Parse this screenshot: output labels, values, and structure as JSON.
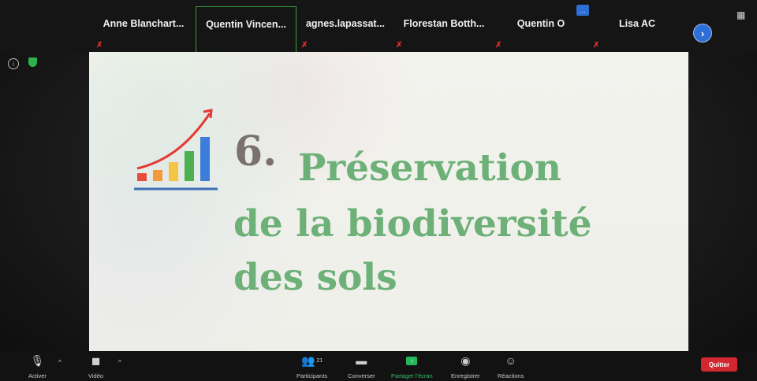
{
  "participants": [
    {
      "name": "Anne  Blanchart..."
    },
    {
      "name": "Quentin  Vincen..."
    },
    {
      "name": "agnes.lapassat..."
    },
    {
      "name": "Florestan  Botth..."
    },
    {
      "name": "Quentin O"
    },
    {
      "name": "Lisa AC"
    }
  ],
  "slide": {
    "number": "6.",
    "title_line1": "Préservation",
    "title_line2": "de la biodiversité",
    "title_line3": "des sols"
  },
  "toolbar": {
    "activer": "Activer",
    "video": "Vidéo",
    "participants": "Participants",
    "participants_count": "21",
    "converser": "Converser",
    "partager": "Partager l'écran",
    "enregistrer": "Enregistrer",
    "reactions": "Réactions",
    "quitter": "Quitter"
  },
  "colors": {
    "slide_title_green": "#6db078",
    "slide_number_gray": "#7a706c",
    "quit_red": "#d3272f",
    "share_green": "#25b55a",
    "accent_blue": "#2d6fd6"
  },
  "icons": [
    "info-icon",
    "shield-icon",
    "chevron-right-icon",
    "view-icon",
    "mic-muted-icon",
    "video-off-icon",
    "participants-icon",
    "chat-icon",
    "share-screen-icon",
    "record-icon",
    "reactions-icon",
    "chart-growth-icon"
  ]
}
